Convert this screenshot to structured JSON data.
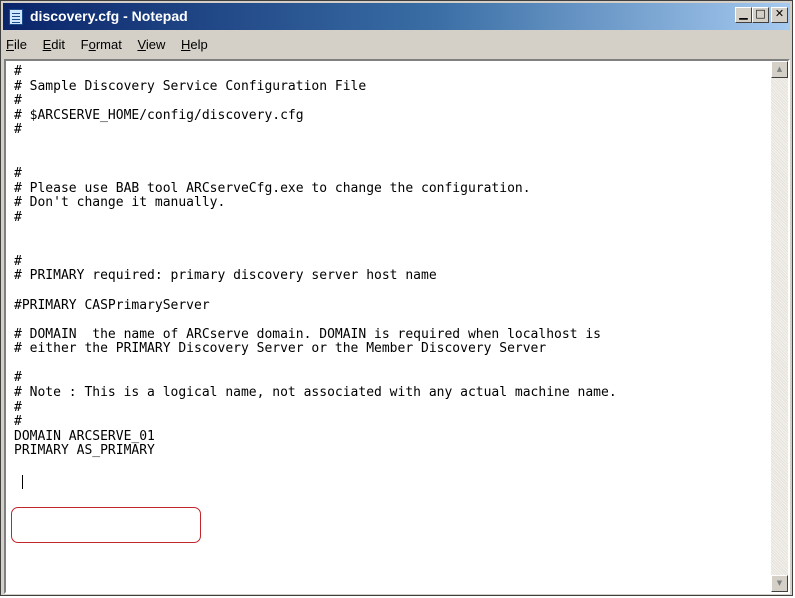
{
  "window": {
    "title": "discovery.cfg - Notepad",
    "minimize_glyph": "▁",
    "maximize_glyph": "□",
    "close_glyph": "✕"
  },
  "menu": {
    "file": {
      "underline": "F",
      "rest": "ile"
    },
    "edit": {
      "underline": "E",
      "rest": "dit"
    },
    "format": {
      "before": "F",
      "underline": "o",
      "after": "rmat"
    },
    "view": {
      "underline": "V",
      "rest": "iew"
    },
    "help": {
      "underline": "H",
      "rest": "elp"
    }
  },
  "document": {
    "content": "#\n# Sample Discovery Service Configuration File\n#\n# $ARCSERVE_HOME/config/discovery.cfg\n#\n\n\n#\n# Please use BAB tool ARCserveCfg.exe to change the configuration.\n# Don't change it manually.\n#\n\n\n#\n# PRIMARY required: primary discovery server host name\n\n#PRIMARY CASPrimaryServer\n\n# DOMAIN  the name of ARCserve domain. DOMAIN is required when localhost is\n# either the PRIMARY Discovery Server or the Member Discovery Server\n\n#\n# Note : This is a logical name, not associated with any actual machine name.\n#\n#\nDOMAIN ARCSERVE_01\nPRIMARY AS_PRIMARY"
  },
  "scrollbar": {
    "up_glyph": "▲",
    "down_glyph": "▼"
  },
  "colors": {
    "highlight_border": "#c0262b",
    "titlebar_start": "#0a246a"
  }
}
